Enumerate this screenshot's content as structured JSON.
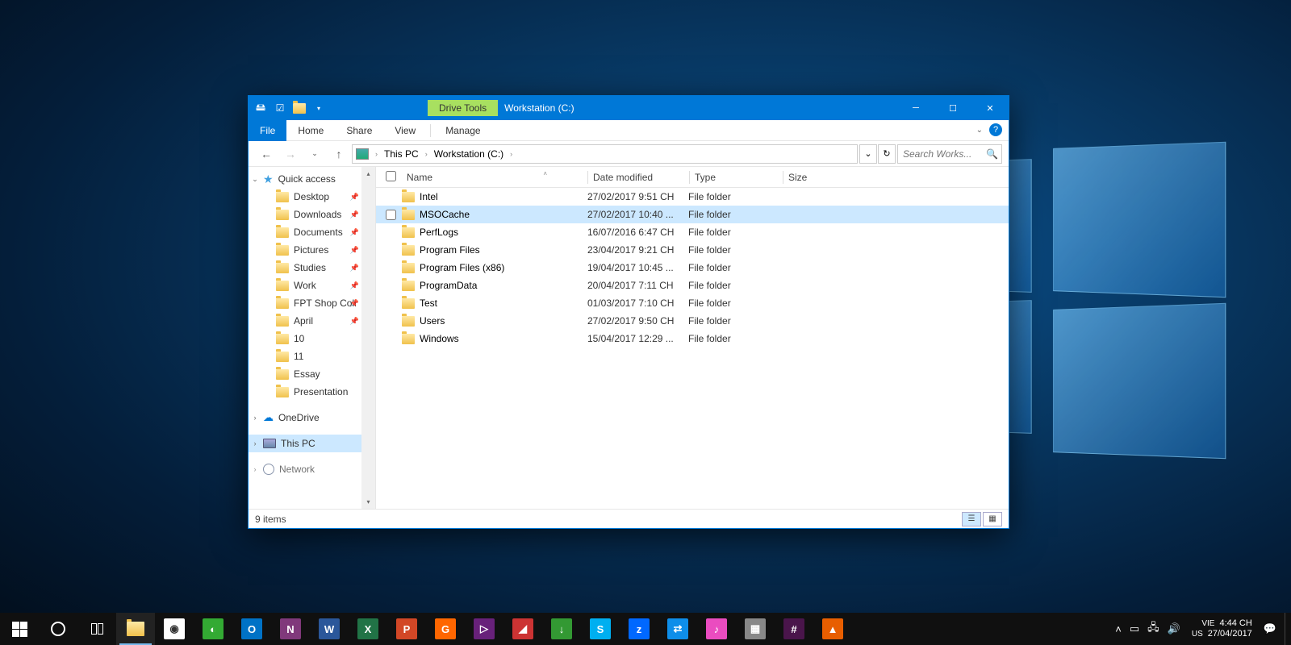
{
  "window": {
    "title": "Workstation (C:)",
    "context_tab": "Drive Tools",
    "tabs": {
      "file": "File",
      "home": "Home",
      "share": "Share",
      "view": "View",
      "manage": "Manage"
    }
  },
  "breadcrumb": {
    "pc": "This PC",
    "drive": "Workstation (C:)"
  },
  "search": {
    "placeholder": "Search Works..."
  },
  "columns": {
    "name": "Name",
    "date": "Date modified",
    "type": "Type",
    "size": "Size"
  },
  "files": [
    {
      "name": "Intel",
      "date": "27/02/2017 9:51 CH",
      "type": "File folder"
    },
    {
      "name": "MSOCache",
      "date": "27/02/2017 10:40 ...",
      "type": "File folder",
      "selected": true
    },
    {
      "name": "PerfLogs",
      "date": "16/07/2016 6:47 CH",
      "type": "File folder"
    },
    {
      "name": "Program Files",
      "date": "23/04/2017 9:21 CH",
      "type": "File folder"
    },
    {
      "name": "Program Files (x86)",
      "date": "19/04/2017 10:45 ...",
      "type": "File folder"
    },
    {
      "name": "ProgramData",
      "date": "20/04/2017 7:11 CH",
      "type": "File folder"
    },
    {
      "name": "Test",
      "date": "01/03/2017 7:10 CH",
      "type": "File folder"
    },
    {
      "name": "Users",
      "date": "27/02/2017 9:50 CH",
      "type": "File folder"
    },
    {
      "name": "Windows",
      "date": "15/04/2017 12:29 ...",
      "type": "File folder"
    }
  ],
  "nav": {
    "quick": "Quick access",
    "items": [
      {
        "label": "Desktop",
        "pinned": true
      },
      {
        "label": "Downloads",
        "pinned": true
      },
      {
        "label": "Documents",
        "pinned": true
      },
      {
        "label": "Pictures",
        "pinned": true
      },
      {
        "label": "Studies",
        "pinned": true
      },
      {
        "label": "Work",
        "pinned": true
      },
      {
        "label": "FPT Shop Coll",
        "pinned": true
      },
      {
        "label": "April",
        "pinned": true
      },
      {
        "label": "10",
        "pinned": false
      },
      {
        "label": "11",
        "pinned": false
      },
      {
        "label": "Essay",
        "pinned": false
      },
      {
        "label": "Presentation",
        "pinned": false
      }
    ],
    "onedrive": "OneDrive",
    "thispc": "This PC",
    "network": "Network"
  },
  "status": {
    "count": "9 items"
  },
  "taskbar": {
    "apps": [
      {
        "name": "chrome",
        "bg": "#fff",
        "fg": "#333",
        "txt": "◉"
      },
      {
        "name": "coccoc",
        "bg": "#3a3",
        "fg": "#fff",
        "txt": "◐"
      },
      {
        "name": "outlook",
        "bg": "#0072c6",
        "fg": "#fff",
        "txt": "O"
      },
      {
        "name": "onenote",
        "bg": "#80397b",
        "fg": "#fff",
        "txt": "N"
      },
      {
        "name": "word",
        "bg": "#2b579a",
        "fg": "#fff",
        "txt": "W"
      },
      {
        "name": "excel",
        "bg": "#217346",
        "fg": "#fff",
        "txt": "X"
      },
      {
        "name": "powerpoint",
        "bg": "#d24726",
        "fg": "#fff",
        "txt": "P"
      },
      {
        "name": "foxit",
        "bg": "#f60",
        "fg": "#fff",
        "txt": "G"
      },
      {
        "name": "visualstudio",
        "bg": "#68217a",
        "fg": "#fff",
        "txt": "▷"
      },
      {
        "name": "app1",
        "bg": "#c33",
        "fg": "#fff",
        "txt": "◢"
      },
      {
        "name": "idm",
        "bg": "#393",
        "fg": "#fff",
        "txt": "↓"
      },
      {
        "name": "skype",
        "bg": "#00aff0",
        "fg": "#fff",
        "txt": "S"
      },
      {
        "name": "zalo",
        "bg": "#0068ff",
        "fg": "#fff",
        "txt": "z"
      },
      {
        "name": "teamviewer",
        "bg": "#0e8ee9",
        "fg": "#fff",
        "txt": "⇄"
      },
      {
        "name": "itunes",
        "bg": "#ea4cc0",
        "fg": "#fff",
        "txt": "♪"
      },
      {
        "name": "app2",
        "bg": "#888",
        "fg": "#fff",
        "txt": "▦"
      },
      {
        "name": "slack",
        "bg": "#4a154b",
        "fg": "#fff",
        "txt": "#"
      },
      {
        "name": "vlc",
        "bg": "#e85e00",
        "fg": "#fff",
        "txt": "▲"
      }
    ],
    "lang1": "VIE",
    "lang2": "US",
    "time": "4:44 CH",
    "date": "27/04/2017"
  }
}
